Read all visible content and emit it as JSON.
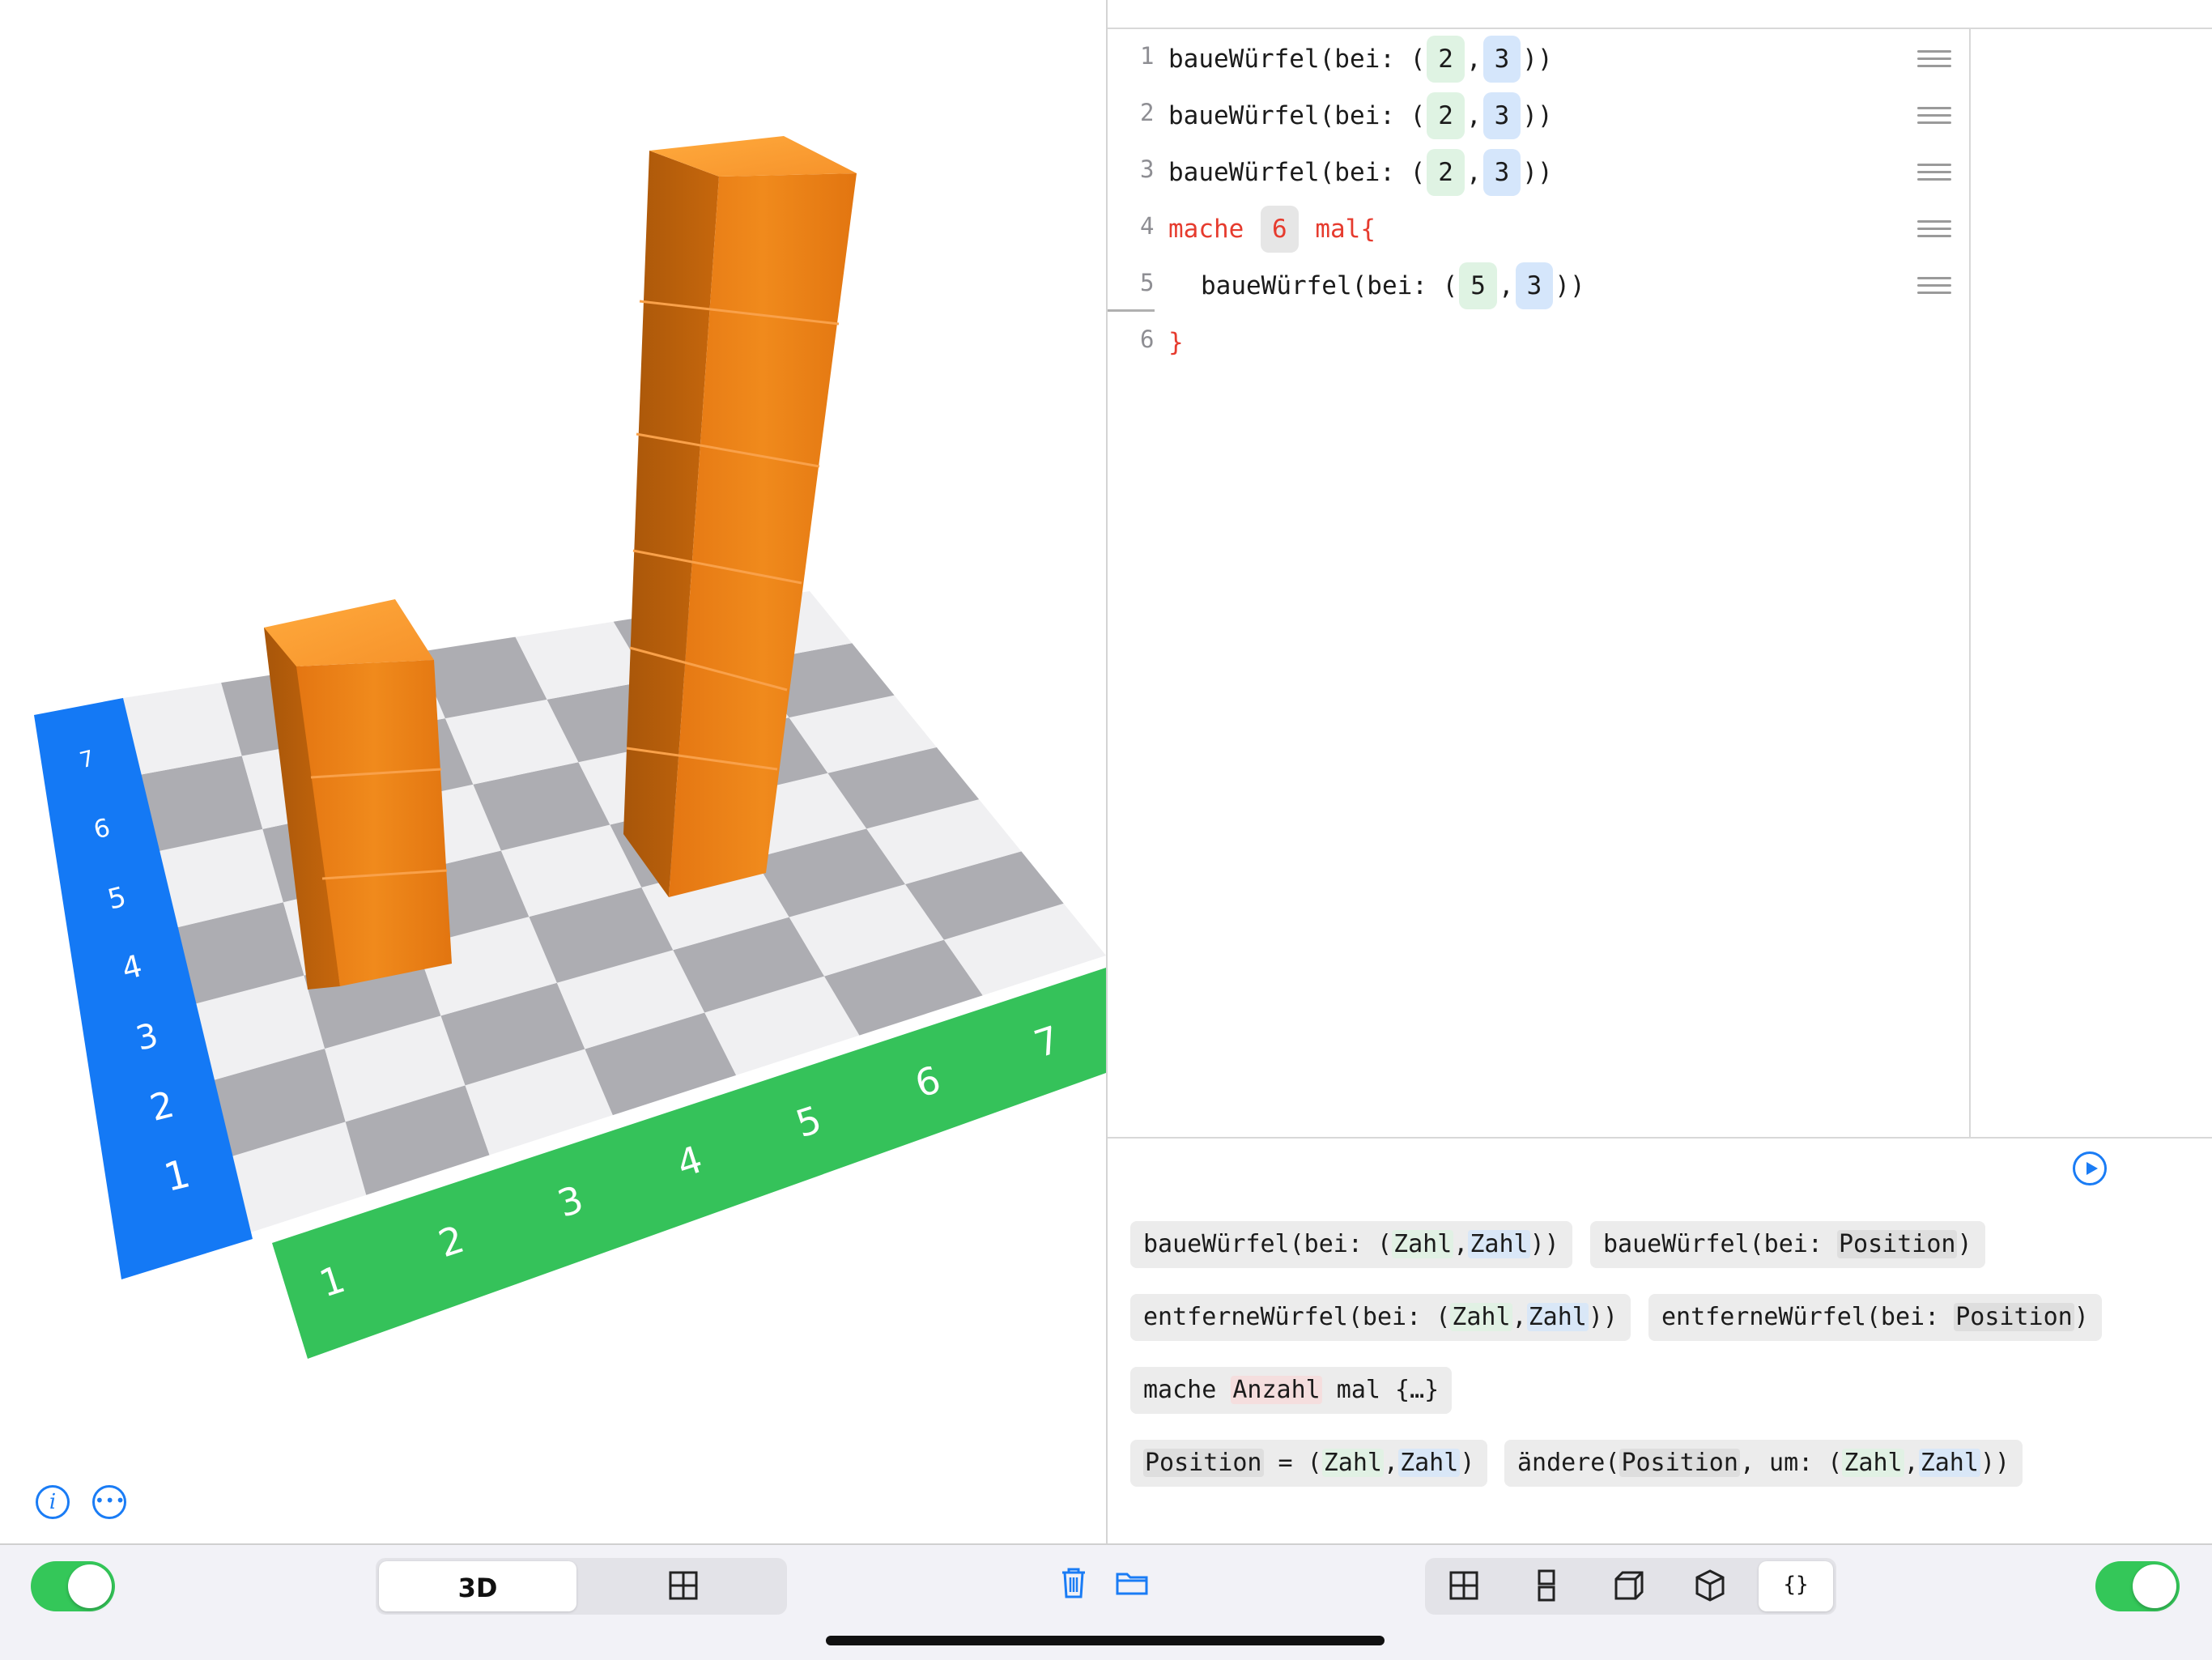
{
  "code": {
    "lines": [
      {
        "num": "1",
        "pre": "baueWürfel(bei: (",
        "a": "2",
        "sep": ",",
        "b": "3",
        "post": "))"
      },
      {
        "num": "2",
        "pre": "baueWürfel(bei: (",
        "a": "2",
        "sep": ",",
        "b": "3",
        "post": "))"
      },
      {
        "num": "3",
        "pre": "baueWürfel(bei: (",
        "a": "2",
        "sep": ",",
        "b": "3",
        "post": "))"
      },
      {
        "num": "4",
        "kw1": "mache",
        "count": "6",
        "kw2": "mal{"
      },
      {
        "num": "5",
        "pre": "baueWürfel(bei: (",
        "a": "5",
        "sep": ",",
        "b": "3",
        "post": "))"
      },
      {
        "num": "6",
        "close": "}"
      }
    ]
  },
  "palette": {
    "chip1_pre": "baueWürfel(bei: (",
    "chip1_t1": "Zahl",
    "chip1_sep": ",",
    "chip1_t2": "Zahl",
    "chip1_post": "))",
    "chip2_pre": "baueWürfel(bei: ",
    "chip2_t1": "Position",
    "chip2_post": ")",
    "chip3_pre": "entferneWürfel(bei: (",
    "chip3_t1": "Zahl",
    "chip3_sep": ",",
    "chip3_t2": "Zahl",
    "chip3_post": "))",
    "chip4_pre": "entferneWürfel(bei: ",
    "chip4_t1": "Position",
    "chip4_post": ")",
    "chip5_pre": "mache ",
    "chip5_t1": "Anzahl",
    "chip5_post": " mal {…}",
    "chip6_t0": "Position",
    "chip6_pre": " = (",
    "chip6_t1": "Zahl",
    "chip6_sep": ",",
    "chip6_t2": "Zahl",
    "chip6_post": ")",
    "chip7_pre": "ändere(",
    "chip7_t0": "Position",
    "chip7_mid": ", um: (",
    "chip7_t1": "Zahl",
    "chip7_sep": ",",
    "chip7_t2": "Zahl",
    "chip7_post": "))"
  },
  "scene": {
    "y_axis_labels": [
      "1",
      "2",
      "3",
      "4",
      "5",
      "6",
      "7"
    ],
    "x_axis_labels": [
      "1",
      "2",
      "3",
      "4",
      "5",
      "6",
      "7"
    ],
    "y_axis_color": "#1479f5",
    "x_axis_color": "#35c25a",
    "cube_color": "#f2861a"
  },
  "toolbar": {
    "view_3d": "3D",
    "code_mode": "{}"
  }
}
